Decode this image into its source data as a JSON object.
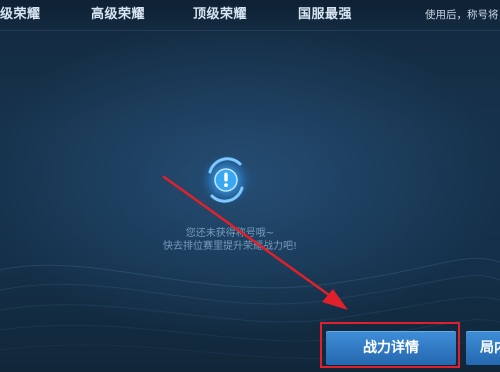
{
  "tabs": [
    {
      "label": "级荣耀"
    },
    {
      "label": "高级荣耀"
    },
    {
      "label": "顶级荣耀"
    },
    {
      "label": "国服最强"
    }
  ],
  "header_hint": "使用后，称号将",
  "empty_state": {
    "icon": "exclamation-icon",
    "line1": "您还未获得称号哦~",
    "line2": "快去排位赛里提升荣耀战力吧!"
  },
  "buttons": {
    "detail_label": "战力详情",
    "second_label": "局内"
  },
  "colors": {
    "background": "#132a40",
    "button": "#2f7ac6",
    "annotation": "#e0202a"
  }
}
